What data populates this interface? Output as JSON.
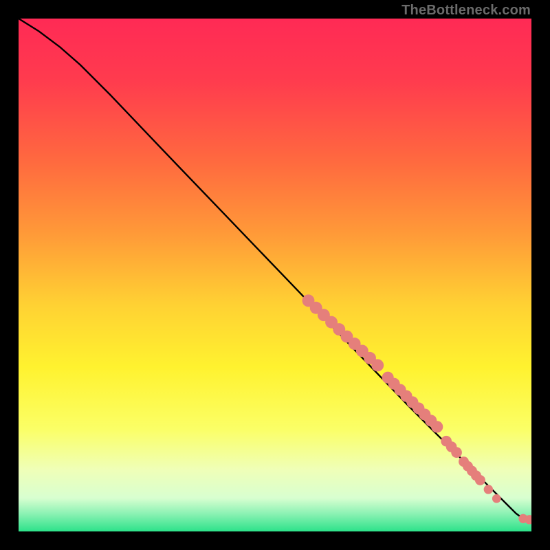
{
  "watermark": "TheBottleneck.com",
  "colors": {
    "gradient_stops": [
      {
        "offset": 0.0,
        "color": "#ff2a55"
      },
      {
        "offset": 0.12,
        "color": "#ff3b4e"
      },
      {
        "offset": 0.28,
        "color": "#ff6a3f"
      },
      {
        "offset": 0.42,
        "color": "#ff9a38"
      },
      {
        "offset": 0.56,
        "color": "#ffd233"
      },
      {
        "offset": 0.68,
        "color": "#fff22f"
      },
      {
        "offset": 0.8,
        "color": "#fbff66"
      },
      {
        "offset": 0.88,
        "color": "#efffb8"
      },
      {
        "offset": 0.935,
        "color": "#d8ffd0"
      },
      {
        "offset": 0.965,
        "color": "#8cf2b4"
      },
      {
        "offset": 1.0,
        "color": "#2de28a"
      }
    ],
    "curve": "#000000",
    "marker": "#e57f7b",
    "black": "#000000"
  },
  "chart_data": {
    "type": "line",
    "title": "",
    "xlabel": "",
    "ylabel": "",
    "xlim": [
      0,
      100
    ],
    "ylim": [
      0,
      100
    ],
    "grid": false,
    "legend": false,
    "series": [
      {
        "name": "bottleneck-curve",
        "x": [
          0,
          4,
          8,
          12,
          18,
          28,
          40,
          52,
          64,
          76,
          86,
          92,
          95,
          97,
          98.5,
          100
        ],
        "y": [
          100,
          97.5,
          94.5,
          91,
          85,
          74.5,
          62,
          49.5,
          37,
          24.5,
          14.5,
          8.5,
          5.5,
          3.5,
          2.4,
          2.3
        ]
      }
    ],
    "markers": [
      {
        "name": "cluster-a",
        "x": 56.5,
        "y": 45.0,
        "r": 1.2
      },
      {
        "name": "cluster-a",
        "x": 58.0,
        "y": 43.6,
        "r": 1.2
      },
      {
        "name": "cluster-a",
        "x": 59.5,
        "y": 42.2,
        "r": 1.2
      },
      {
        "name": "cluster-a",
        "x": 61.0,
        "y": 40.8,
        "r": 1.2
      },
      {
        "name": "cluster-a",
        "x": 62.5,
        "y": 39.4,
        "r": 1.2
      },
      {
        "name": "cluster-a",
        "x": 64.0,
        "y": 38.0,
        "r": 1.2
      },
      {
        "name": "cluster-a",
        "x": 65.5,
        "y": 36.6,
        "r": 1.2
      },
      {
        "name": "cluster-a",
        "x": 67.0,
        "y": 35.2,
        "r": 1.2
      },
      {
        "name": "cluster-a",
        "x": 68.5,
        "y": 33.8,
        "r": 1.2
      },
      {
        "name": "cluster-a",
        "x": 70.0,
        "y": 32.4,
        "r": 1.2
      },
      {
        "name": "cluster-b",
        "x": 72.0,
        "y": 30.0,
        "r": 1.15
      },
      {
        "name": "cluster-b",
        "x": 73.2,
        "y": 28.8,
        "r": 1.15
      },
      {
        "name": "cluster-b",
        "x": 74.4,
        "y": 27.6,
        "r": 1.15
      },
      {
        "name": "cluster-b",
        "x": 75.6,
        "y": 26.4,
        "r": 1.15
      },
      {
        "name": "cluster-b",
        "x": 76.8,
        "y": 25.2,
        "r": 1.15
      },
      {
        "name": "cluster-b",
        "x": 78.0,
        "y": 24.0,
        "r": 1.15
      },
      {
        "name": "cluster-b",
        "x": 79.2,
        "y": 22.8,
        "r": 1.15
      },
      {
        "name": "cluster-b",
        "x": 80.4,
        "y": 21.6,
        "r": 1.15
      },
      {
        "name": "cluster-b",
        "x": 81.6,
        "y": 20.4,
        "r": 1.15
      },
      {
        "name": "cluster-c",
        "x": 83.4,
        "y": 17.6,
        "r": 1.05
      },
      {
        "name": "cluster-c",
        "x": 84.4,
        "y": 16.5,
        "r": 1.05
      },
      {
        "name": "cluster-c",
        "x": 85.4,
        "y": 15.4,
        "r": 1.05
      },
      {
        "name": "cluster-d",
        "x": 86.8,
        "y": 13.6,
        "r": 1.0
      },
      {
        "name": "cluster-d",
        "x": 87.6,
        "y": 12.7,
        "r": 1.0
      },
      {
        "name": "cluster-d",
        "x": 88.4,
        "y": 11.8,
        "r": 1.0
      },
      {
        "name": "cluster-d",
        "x": 89.2,
        "y": 10.9,
        "r": 1.0
      },
      {
        "name": "cluster-d",
        "x": 90.0,
        "y": 10.0,
        "r": 1.0
      },
      {
        "name": "point-e",
        "x": 91.6,
        "y": 8.2,
        "r": 0.9
      },
      {
        "name": "point-f",
        "x": 93.2,
        "y": 6.4,
        "r": 0.85
      },
      {
        "name": "tail-left",
        "x": 98.4,
        "y": 2.5,
        "r": 0.9
      },
      {
        "name": "tail-right",
        "x": 99.6,
        "y": 2.3,
        "r": 0.9
      }
    ]
  }
}
